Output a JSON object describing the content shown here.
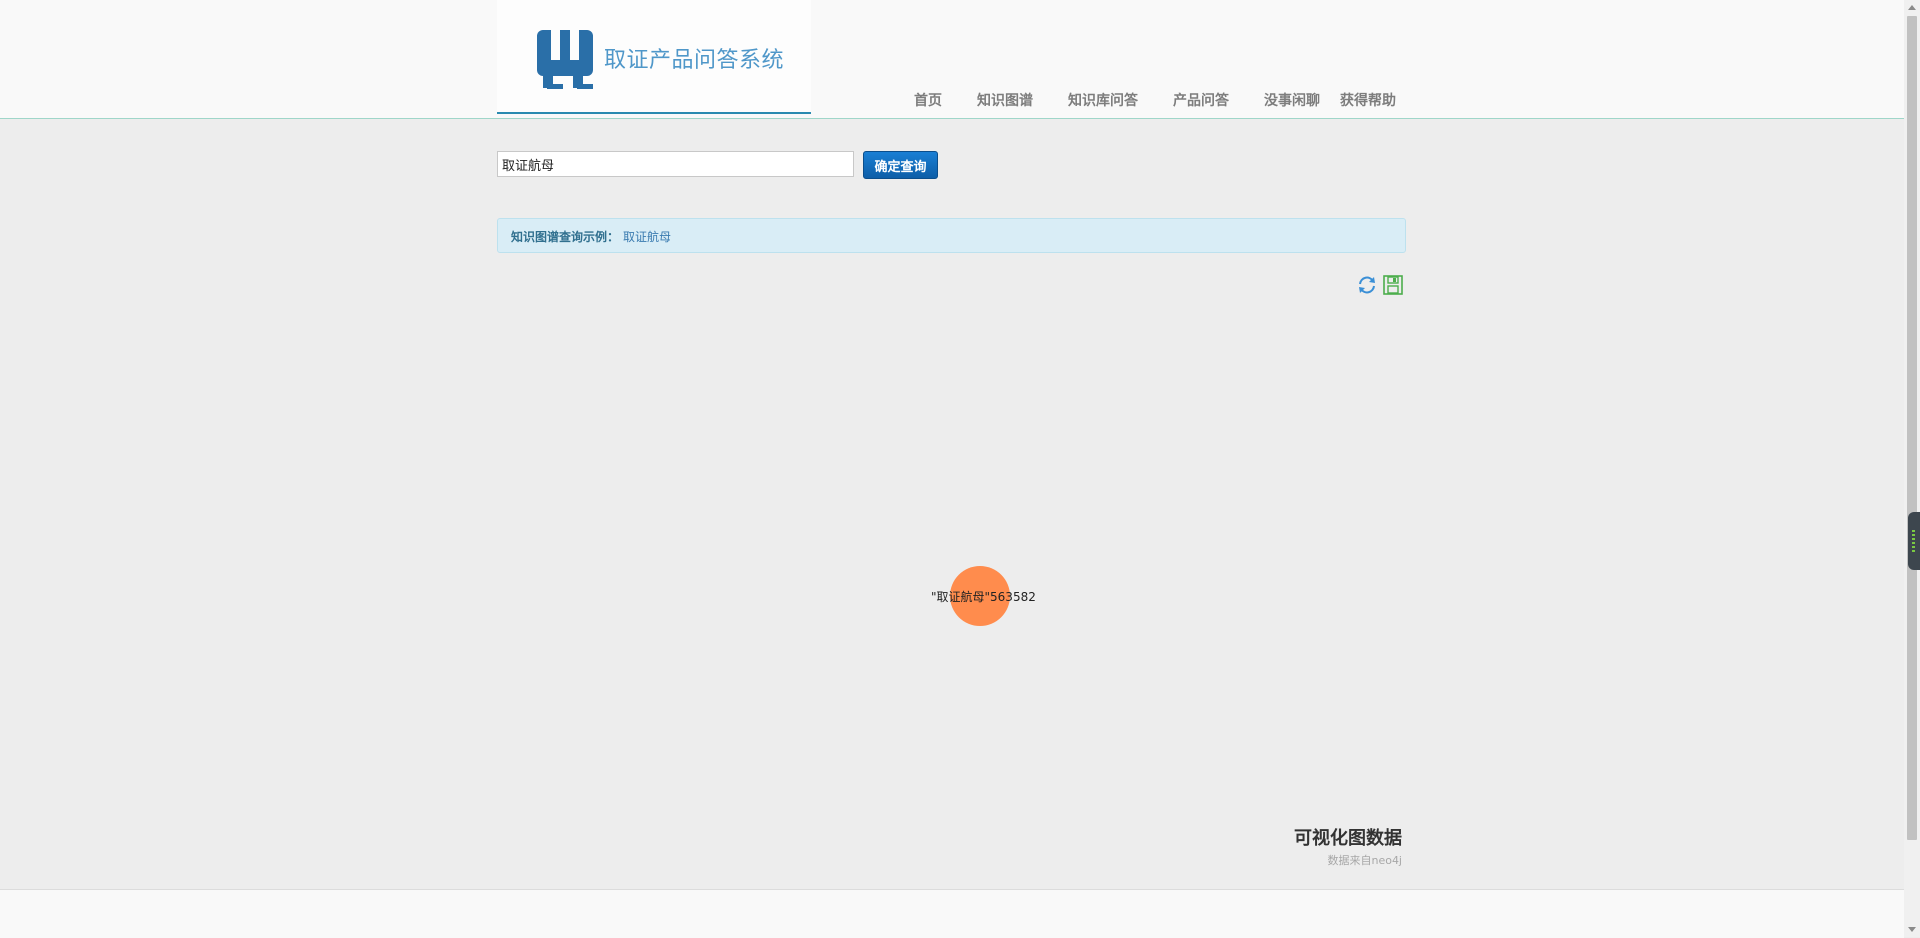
{
  "header": {
    "logo_text": "取证产品问答系统",
    "nav": [
      "首页",
      "知识图谱",
      "知识库问答",
      "产品问答",
      "没事闲聊",
      "获得帮助"
    ]
  },
  "search": {
    "value": "取证航母",
    "button_label": "确定查询"
  },
  "alert": {
    "label": "知识图谱查询示例：",
    "example": "取证航母"
  },
  "toolbar": {
    "refresh_icon": "refresh-icon",
    "save_icon": "save-icon"
  },
  "graph": {
    "node_label": "\"取证航母\"563582",
    "node_color": "#ff8c4d",
    "title": "可视化图数据",
    "source": "数据来自neo4j"
  },
  "colors": {
    "accent": "#1a7fd4",
    "logo": "#2a6fa8",
    "alert_bg": "#d9edf6"
  }
}
